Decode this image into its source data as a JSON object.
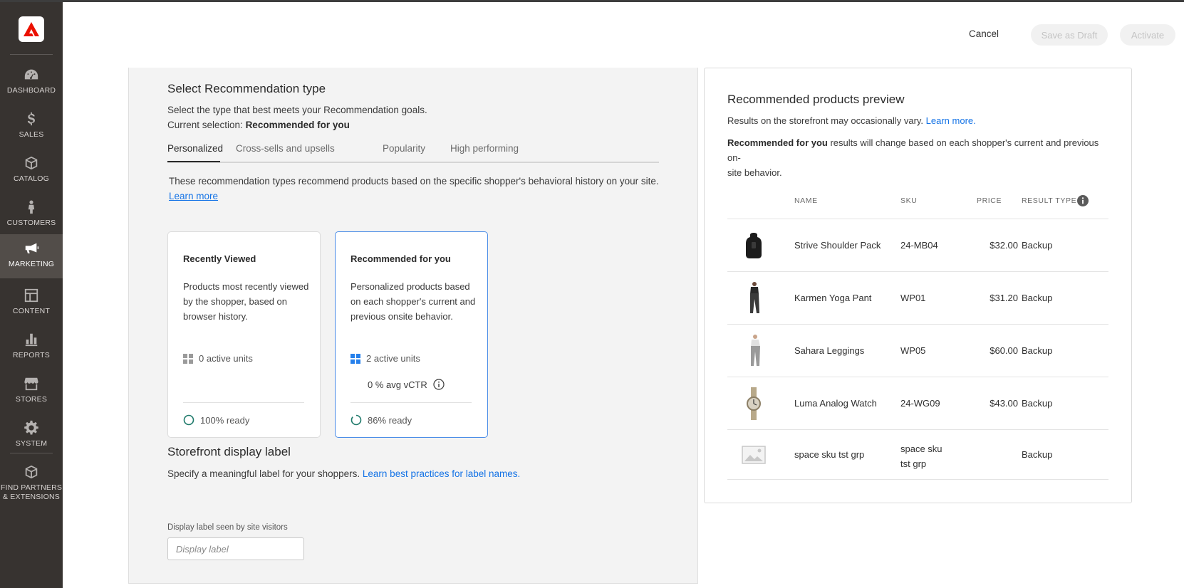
{
  "sidebar": {
    "logo_icon": "adobe-logo-icon",
    "items": [
      {
        "label": "DASHBOARD",
        "icon": "dashboard-icon"
      },
      {
        "label": "SALES",
        "icon": "dollar-icon"
      },
      {
        "label": "CATALOG",
        "icon": "box-icon"
      },
      {
        "label": "CUSTOMERS",
        "icon": "person-icon"
      },
      {
        "label": "MARKETING",
        "icon": "megaphone-icon",
        "active": true
      },
      {
        "label": "CONTENT",
        "icon": "layout-icon"
      },
      {
        "label": "REPORTS",
        "icon": "bar-chart-icon"
      },
      {
        "label": "STORES",
        "icon": "storefront-icon"
      },
      {
        "label": "SYSTEM",
        "icon": "gear-icon"
      },
      {
        "label": "FIND PARTNERS\n& EXTENSIONS",
        "label_line1": "FIND PARTNERS",
        "label_line2": "& EXTENSIONS",
        "icon": "extensions-box-icon"
      }
    ]
  },
  "header": {
    "cancel_label": "Cancel",
    "save_draft_label": "Save as Draft",
    "activate_label": "Activate"
  },
  "recommendation_type": {
    "title": "Select Recommendation type",
    "description": "Select the type that best meets your Recommendation goals.",
    "current_prefix": "Current selection: ",
    "current_value": "Recommended for you",
    "tabs": [
      "Personalized",
      "Cross-sells and upsells",
      "Popularity",
      "High performing"
    ],
    "active_tab": "Personalized",
    "tab_description": "These recommendation types recommend products based on the specific shopper's behavioral history on your site.",
    "learn_more": "Learn more",
    "cards": [
      {
        "title": "Recently Viewed",
        "description": "Products most recently viewed by the shopper, based on browser history.",
        "active_units": "0 active units",
        "ready": "100% ready",
        "ready_fraction": 1.0,
        "selected": false
      },
      {
        "title": "Recommended for you",
        "description": "Personalized products based on each shopper's current and previous onsite behavior.",
        "active_units": "2 active units",
        "vctr": "0 % avg vCTR",
        "ready": "86% ready",
        "ready_fraction": 0.86,
        "selected": true
      }
    ]
  },
  "storefront_label": {
    "title": "Storefront display label",
    "description": "Specify a meaningful label for your shoppers. ",
    "link": "Learn best practices for label names.",
    "field_label": "Display label seen by site visitors",
    "placeholder": "Display label",
    "value": ""
  },
  "preview": {
    "title": "Recommended products preview",
    "note_text": "Results on the storefront may occasionally vary. ",
    "note_link": "Learn more.",
    "behavior_bold": "Recommended for you",
    "behavior_text_line1": " results will change based on each shopper's current and previous on-",
    "behavior_text_line2": "site behavior.",
    "columns": {
      "name": "NAME",
      "sku": "SKU",
      "price": "PRICE",
      "result_type": "RESULT TYPE"
    },
    "rows": [
      {
        "name": "Strive Shoulder Pack",
        "sku": "24-MB04",
        "price": "$32.00",
        "result_type": "Backup",
        "thumb": "backpack-icon"
      },
      {
        "name": "Karmen Yoga Pant",
        "sku": "WP01",
        "price": "$31.20",
        "result_type": "Backup",
        "thumb": "pants-icon"
      },
      {
        "name": "Sahara Leggings",
        "sku": "WP05",
        "price": "$60.00",
        "result_type": "Backup",
        "thumb": "leggings-icon"
      },
      {
        "name": "Luma Analog Watch",
        "sku": "24-WG09",
        "price": "$43.00",
        "result_type": "Backup",
        "thumb": "watch-icon"
      },
      {
        "name": "space sku tst grp",
        "sku_line1": "space sku",
        "sku_line2": "tst grp",
        "price": "",
        "result_type": "Backup",
        "thumb": "image-placeholder-icon"
      }
    ]
  },
  "colors": {
    "accent": "#1473e6",
    "sidebar": "#373330",
    "selected_border": "#4b8de7",
    "ready_ring": "#1f7a6b"
  }
}
